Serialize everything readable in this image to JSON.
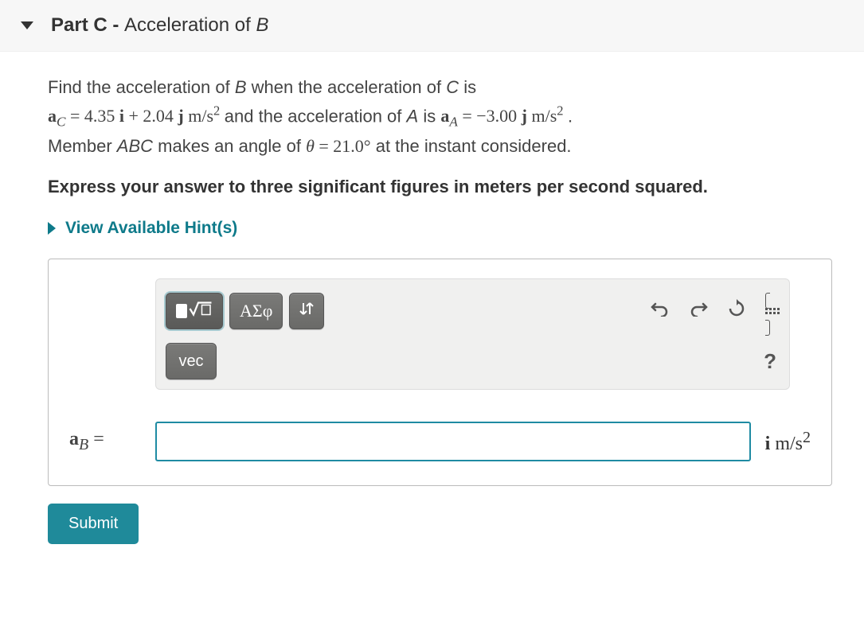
{
  "part": {
    "label": "Part C",
    "separator": " - ",
    "title_pre": "Acceleration of ",
    "title_var": "B"
  },
  "problem": {
    "line1_pre": "Find the acceleration of ",
    "B": "B",
    "line1_mid": " when the acceleration of ",
    "C": "C",
    "line1_post": " is",
    "aC_lhs": "a",
    "aC_sub": "C",
    "equals": " = ",
    "aC_val_i": "4.35",
    "i": " i ",
    "plus": "+ ",
    "aC_val_j": "2.04",
    "j": " j ",
    "unit": "m/s",
    "sq": "2",
    "and_text": " and the acceleration of ",
    "A": "A",
    "is_text": " is ",
    "aA_lhs": "a",
    "aA_sub": "A",
    "aA_val": "−3.00",
    "period": " .",
    "line3_pre": "Member ",
    "ABC": "ABC",
    "angle_text": " makes an angle of ",
    "theta": "θ",
    "theta_val": "21.0",
    "deg": "°",
    "instant": " at the instant considered."
  },
  "instruct": "Express your answer to three significant figures in meters per second squared.",
  "hints_label": "View Available Hint(s)",
  "toolbar": {
    "greek": "ΑΣφ",
    "vec": "vec",
    "help": "?"
  },
  "answer": {
    "lhs_var": "a",
    "lhs_sub": "B",
    "lhs_eq": " = ",
    "value": "",
    "unit_i": "i ",
    "unit": "m/s",
    "unit_sq": "2"
  },
  "submit": "Submit"
}
